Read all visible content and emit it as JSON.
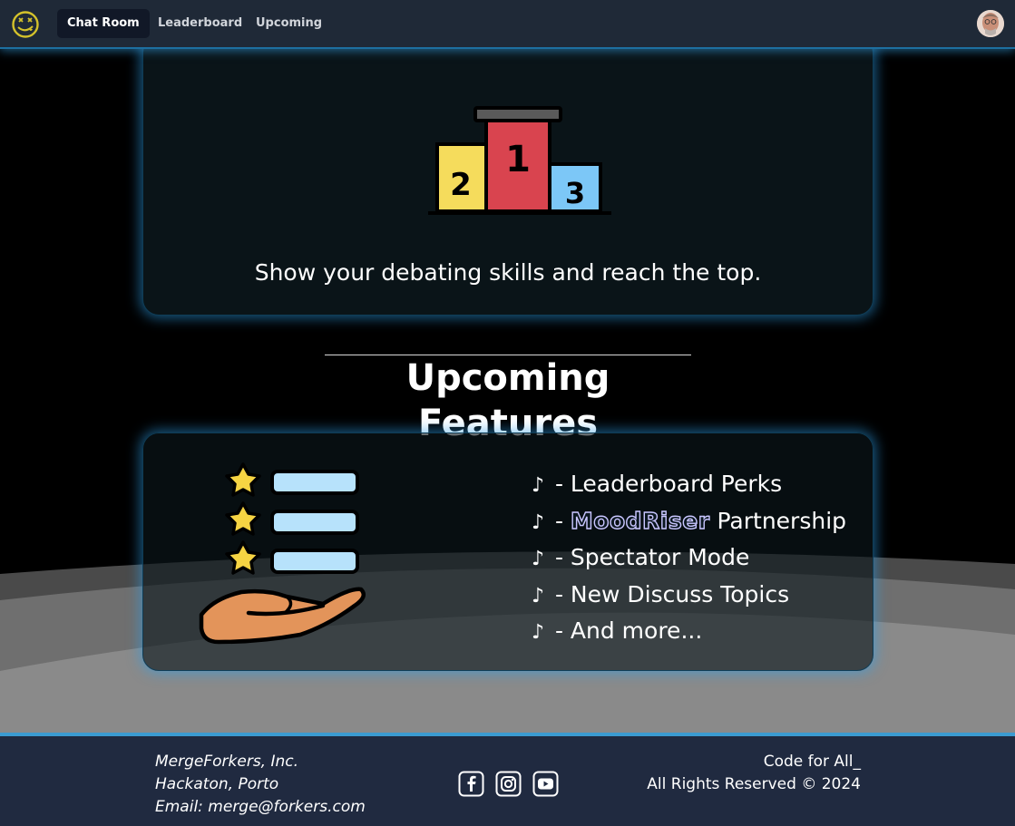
{
  "nav": {
    "logo_icon": "smiley-logo-icon",
    "links": [
      {
        "label": "Chat Room",
        "active": true
      },
      {
        "label": "Leaderboard",
        "active": false
      },
      {
        "label": "Upcoming",
        "active": false
      }
    ],
    "avatar_icon": "user-avatar-icon"
  },
  "hero_card": {
    "illustration_icon": "podium-icon",
    "podium_places": [
      "2",
      "1",
      "3"
    ],
    "caption": "Show your debating skills and reach the top."
  },
  "section": {
    "heading": "Upcoming Features"
  },
  "features_card": {
    "illustration_icon": "hand-holding-rated-list-icon",
    "bullet": "♪",
    "items": [
      {
        "prefix": " - ",
        "text": "Leaderboard Perks"
      },
      {
        "prefix": " - ",
        "brand": "MoodRiser",
        "text": " Partnership"
      },
      {
        "prefix": " - ",
        "text": "Spectator Mode"
      },
      {
        "prefix": " - ",
        "text": "New Discuss Topics"
      },
      {
        "prefix": " - ",
        "text": "And more..."
      }
    ]
  },
  "footer": {
    "company": "MergeForkers, Inc.",
    "location": "Hackaton, Porto",
    "email": "Email: merge@forkers.com",
    "social_icons": [
      "facebook-icon",
      "instagram-icon",
      "youtube-icon"
    ],
    "tagline": "Code for All_",
    "rights": "All Rights Reserved © 2024"
  },
  "colors": {
    "navbar_bg": "#1f2937",
    "glow": "#2da0eb",
    "footer_bg": "#202a40",
    "podium_first": "#d9444f",
    "podium_second": "#f5dc5c",
    "podium_third": "#7cc7f7"
  }
}
